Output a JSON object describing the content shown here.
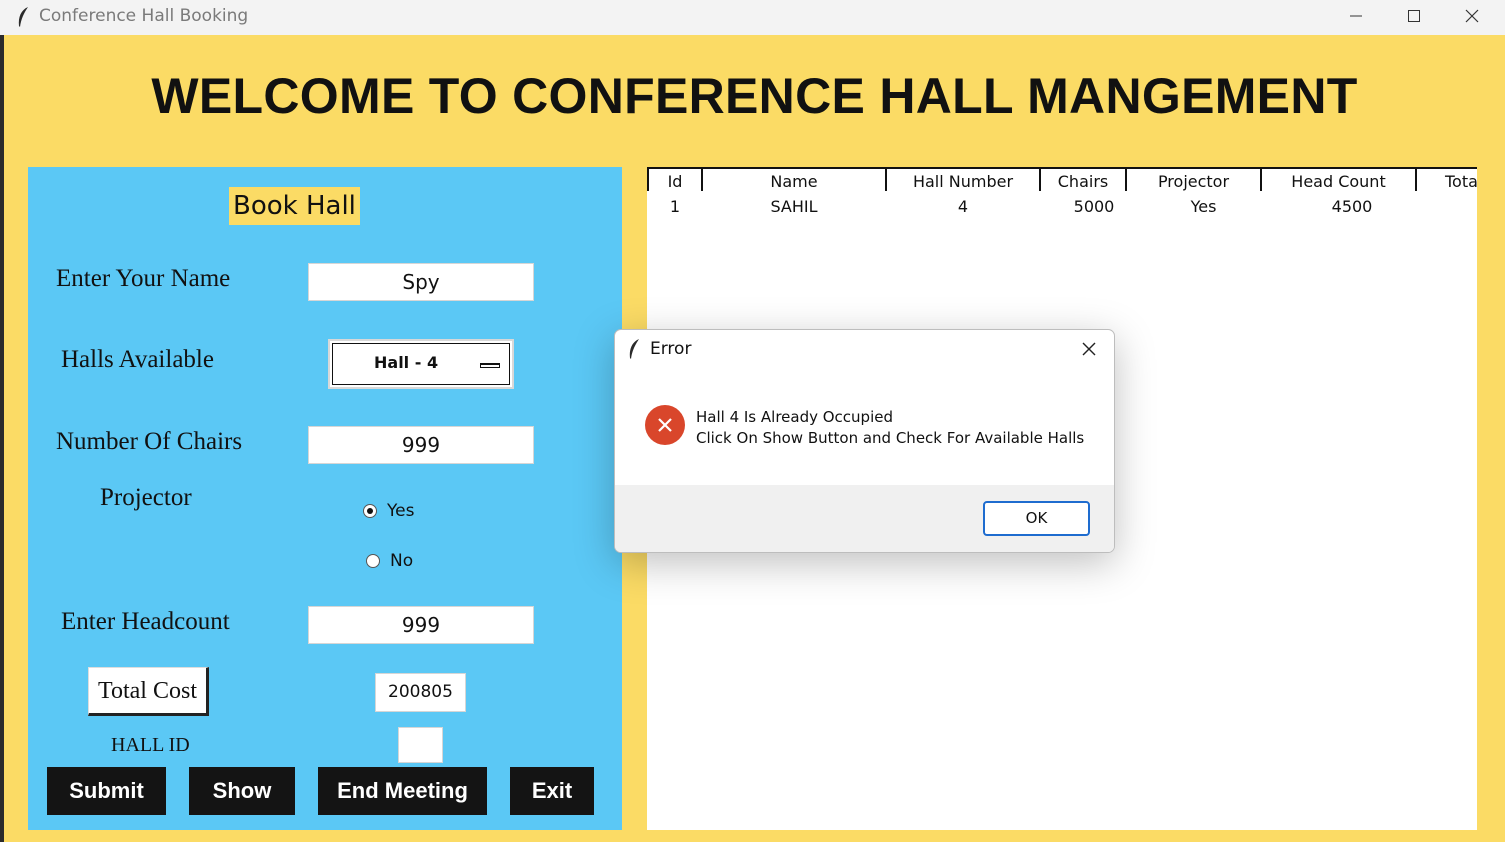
{
  "window": {
    "title": "Conference Hall Booking",
    "icon": "feather-icon",
    "controls": [
      "minimize-icon",
      "maximize-icon",
      "close-icon"
    ]
  },
  "heading": "WELCOME TO CONFERENCE HALL MANGEMENT",
  "form": {
    "title": "Book Hall",
    "name_label": "Enter Your Name",
    "name_value": "Spy",
    "halls_label": "Halls Available",
    "halls_selected": "Hall - 4",
    "chairs_label": "Number Of Chairs",
    "chairs_value": "999",
    "projector_label": "Projector",
    "projector_options": [
      {
        "label": "Yes",
        "selected": true
      },
      {
        "label": "No",
        "selected": false
      }
    ],
    "headcount_label": "Enter Headcount",
    "headcount_value": "999",
    "total_cost_button": "Total Cost",
    "total_cost_value": "200805",
    "hall_id_label": "HALL ID",
    "hall_id_value": "",
    "buttons": {
      "submit": "Submit",
      "show": "Show",
      "end_meeting": "End Meeting",
      "exit": "Exit"
    }
  },
  "table": {
    "columns": [
      "Id",
      "Name",
      "Hall Number",
      "Chairs",
      "Projector",
      "Head Count",
      "Tota"
    ],
    "rows": [
      [
        "1",
        "SAHIL",
        "4",
        "5000",
        "Yes",
        "4500",
        ""
      ]
    ]
  },
  "dialog": {
    "title": "Error",
    "icon": "error-icon",
    "message_line1": "Hall 4 Is Already Occupied",
    "message_line2": "Click On Show Button and Check For Available Halls",
    "ok_label": "OK"
  },
  "colors": {
    "background": "#fbdb65",
    "panel": "#5bc8f5",
    "button_dark": "#141414",
    "error_red": "#d9462b",
    "focus_blue": "#1e6ccf"
  }
}
